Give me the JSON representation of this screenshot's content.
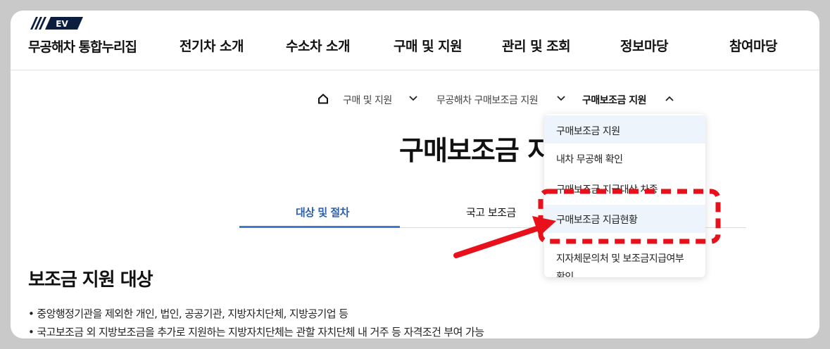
{
  "header": {
    "logo_text": "EV",
    "site_title": "무공해차 통합누리집",
    "nav": [
      "전기차 소개",
      "수소차 소개",
      "구매 및 지원",
      "관리 및 조회",
      "정보마당",
      "참여마당"
    ]
  },
  "breadcrumb": {
    "home_icon": "home-icon",
    "items": [
      "구매 및 지원",
      "무공해차 구매보조금 지원",
      "구매보조금 지원"
    ]
  },
  "dropdown": {
    "items": [
      "구매보조금 지원",
      "내차 무공해 확인",
      "구매보조금 지급대상 차종",
      "구매보조금 지급현황",
      "지자체문의처 및 보조금지급여부",
      "확인"
    ],
    "selected": "구매보조금 지원",
    "highlighted": "구매보조금 지급현황"
  },
  "page": {
    "title": "구매보조금 지"
  },
  "tabs": [
    "대상 및 절차",
    "국고 보조금"
  ],
  "section": {
    "title": "보조금 지원 대상",
    "bullets": [
      "• 중앙행정기관을 제외한 개인, 법인, 공공기관, 지방자치단체, 지방공기업 등",
      "• 국고보조금 외 지방보조금을 추가로 지원하는 지방자치단체는 관할 자치단체 내 거주 등 자격조건 부여 가능"
    ]
  },
  "annotation": {
    "highlight_color": "#e8101a",
    "shape": "dashed-rounded-rectangle",
    "arrow": "red-arrow-pointing-left-up"
  }
}
